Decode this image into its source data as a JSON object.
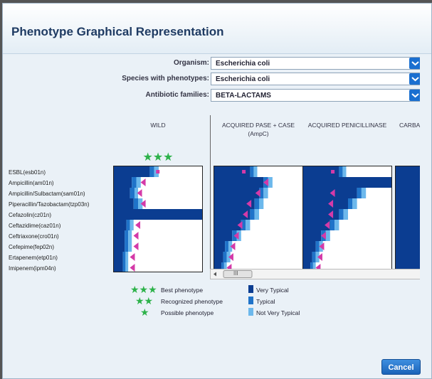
{
  "dialog": {
    "title": "Phenotype Graphical Representation"
  },
  "filters": [
    {
      "label": "Organism:",
      "value": "Escherichia coli"
    },
    {
      "label": "Species with phenotypes:",
      "value": "Escherichia coli"
    },
    {
      "label": "Antibiotic families:",
      "value": "BETA-LACTAMS"
    }
  ],
  "columns": [
    {
      "header": "WILD",
      "stars": "★★★"
    },
    {
      "header": "ACQUIRED PASE + CASE",
      "sub": "(AmpC)"
    },
    {
      "header": "ACQUIRED PENICILLINASE"
    },
    {
      "header": "CARBA"
    }
  ],
  "drugs": [
    "ESBL(esb01n)",
    "Ampicillin(am01n)",
    "Ampicillin/Sulbactam(sam01n)",
    "Piperacillin/Tazobactam(tzp03n)",
    "Cefazolin(cz01n)",
    "Ceftazidime(caz01n)",
    "Ceftriaxone(cro01n)",
    "Cefepime(fep02n)",
    "Ertapenem(etp01n)",
    "Imipenem(ipm04n)"
  ],
  "scrollbar": {
    "thumb_label": "III"
  },
  "legend": {
    "stars": [
      {
        "symbol": "★★★",
        "label": "Best phenotype"
      },
      {
        "symbol": "★★",
        "label": "Recognized phenotype"
      },
      {
        "symbol": "★",
        "label": "Possible phenotype"
      }
    ],
    "typicality": [
      {
        "label": "Very Typical",
        "color": "#0b3d91"
      },
      {
        "label": "Typical",
        "color": "#1f73c9"
      },
      {
        "label": "Not Very Typical",
        "color": "#6cb8ec"
      }
    ]
  },
  "buttons": {
    "cancel": "Cancel"
  },
  "colors": {
    "marker": "#d43aa8",
    "very_typical": "#0b3d91",
    "typical": "#1f73c9",
    "not_very_typical": "#6cb8ec",
    "star": "#2db24a"
  },
  "grids": [
    {
      "name": "wild",
      "rows": [
        [
          0.4,
          0.05,
          0.05,
          "s",
          0.49
        ],
        [
          0.2,
          0.05,
          0.05,
          "t",
          0.33
        ],
        [
          0.18,
          0.05,
          0.04,
          "t",
          0.29
        ],
        [
          0.22,
          0.05,
          0.05,
          "t",
          0.33
        ],
        [
          1.0,
          0,
          0,
          "n",
          0
        ],
        [
          0.14,
          0.04,
          0.04,
          "t",
          0.27
        ],
        [
          0.12,
          0.04,
          0.04,
          "t",
          0.25
        ],
        [
          0.12,
          0.04,
          0.04,
          "t",
          0.25
        ],
        [
          0.1,
          0.03,
          0.03,
          "t",
          0.21
        ],
        [
          0.1,
          0.03,
          0.03,
          "t",
          0.21
        ]
      ]
    },
    {
      "name": "ampc",
      "rows": [
        [
          0.4,
          0.04,
          0.04,
          "s",
          0.33
        ],
        [
          0.55,
          0.05,
          0.05,
          "t",
          0.58
        ],
        [
          0.5,
          0.05,
          0.05,
          "t",
          0.49
        ],
        [
          0.45,
          0.05,
          0.05,
          "t",
          0.39
        ],
        [
          0.4,
          0.05,
          0.05,
          "t",
          0.35
        ],
        [
          0.3,
          0.05,
          0.05,
          "t",
          0.29
        ],
        [
          0.2,
          0.05,
          0.05,
          "t",
          0.25
        ],
        [
          0.12,
          0.04,
          0.04,
          "t",
          0.21
        ],
        [
          0.1,
          0.04,
          0.04,
          "t",
          0.19
        ],
        [
          0.08,
          0.03,
          0.03,
          "t",
          0.17
        ]
      ]
    },
    {
      "name": "penicillinase",
      "rows": [
        [
          0.4,
          0.04,
          0.04,
          "s",
          0.33
        ],
        [
          1.0,
          0,
          0,
          "n",
          0
        ],
        [
          0.6,
          0.05,
          0.05,
          "t",
          0.33
        ],
        [
          0.5,
          0.05,
          0.05,
          "t",
          0.31
        ],
        [
          0.4,
          0.05,
          0.05,
          "t",
          0.31
        ],
        [
          0.3,
          0.05,
          0.05,
          "t",
          0.27
        ],
        [
          0.2,
          0.05,
          0.05,
          "t",
          0.23
        ],
        [
          0.14,
          0.04,
          0.04,
          "t",
          0.21
        ],
        [
          0.1,
          0.04,
          0.04,
          "t",
          0.19
        ],
        [
          0.08,
          0.03,
          0.03,
          "t",
          0.17
        ]
      ]
    },
    {
      "name": "carba",
      "rows": [
        [
          0.4,
          0.04,
          0.04,
          "s",
          0.43
        ],
        [
          1.0,
          0,
          0,
          "n",
          0
        ],
        [
          0.9,
          0.05,
          0.05,
          "n",
          0
        ],
        [
          1.0,
          0,
          0,
          "n",
          0
        ],
        [
          1.0,
          0,
          0,
          "n",
          0
        ],
        [
          0.8,
          0.05,
          0.05,
          "n",
          0
        ],
        [
          0.75,
          0.05,
          0.05,
          "n",
          0
        ],
        [
          0.7,
          0.05,
          0.05,
          "n",
          0
        ],
        [
          0.6,
          0.05,
          0.05,
          "t",
          0.86
        ],
        [
          0.55,
          0.05,
          0.05,
          "t",
          0.86
        ]
      ]
    }
  ]
}
